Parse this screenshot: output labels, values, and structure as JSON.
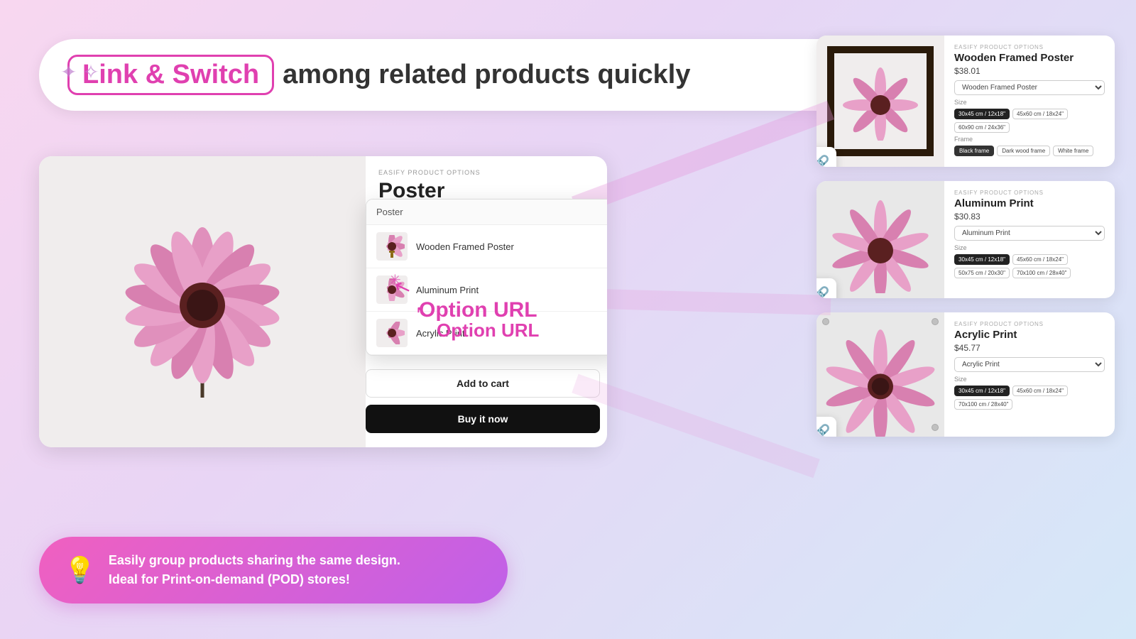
{
  "header": {
    "brand_label": "Link & Switch",
    "tagline": " among related products quickly",
    "sparkle": "✦ ✧"
  },
  "main_card": {
    "easify_label": "EASIFY PRODUCT OPTIONS",
    "product_title": "Poster",
    "dropdown_header": "Poster",
    "items": [
      {
        "label": "Wooden Framed Poster"
      },
      {
        "label": "Aluminum Print"
      },
      {
        "label": "Acrylic Print"
      }
    ],
    "option_url": "Option URL",
    "add_to_cart": "Add to cart",
    "buy_now": "Buy it now"
  },
  "right_cards": [
    {
      "easify_label": "EASIFY PRODUCT OPTIONS",
      "title": "Wooden Framed Poster",
      "price": "$38.01",
      "dropdown_value": "Wooden Framed Poster",
      "size_label": "Size",
      "sizes": [
        "30x45 cm / 12x18\"",
        "45x60 cm / 18x24\"",
        "60x90 cm / 24x36\""
      ],
      "active_size": 0,
      "frame_label": "Frame",
      "frames": [
        "Black frame",
        "Dark wood frame",
        "White frame"
      ],
      "active_frame": 0
    },
    {
      "easify_label": "EASIFY PRODUCT OPTIONS",
      "title": "Aluminum Print",
      "price": "$30.83",
      "dropdown_value": "Aluminum Print",
      "size_label": "Size",
      "sizes": [
        "30x45 cm / 12x18\"",
        "45x60 cm / 18x24\"",
        "50x75 cm / 20x30\"",
        "70x100 cm / 28x40\""
      ],
      "active_size": 0
    },
    {
      "easify_label": "EASIFY PRODUCT OPTIONS",
      "title": "Acrylic Print",
      "price": "$45.77",
      "dropdown_value": "Acrylic Print",
      "size_label": "Size",
      "sizes": [
        "30x45 cm / 12x18\"",
        "45x60 cm / 18x24\"",
        "70x100 cm / 28x40\""
      ],
      "active_size": 0
    }
  ],
  "bottom_banner": {
    "icon": "💡",
    "line1": "Easily group products sharing the same design.",
    "line2": "Ideal for Print-on-demand (POD) stores!"
  }
}
